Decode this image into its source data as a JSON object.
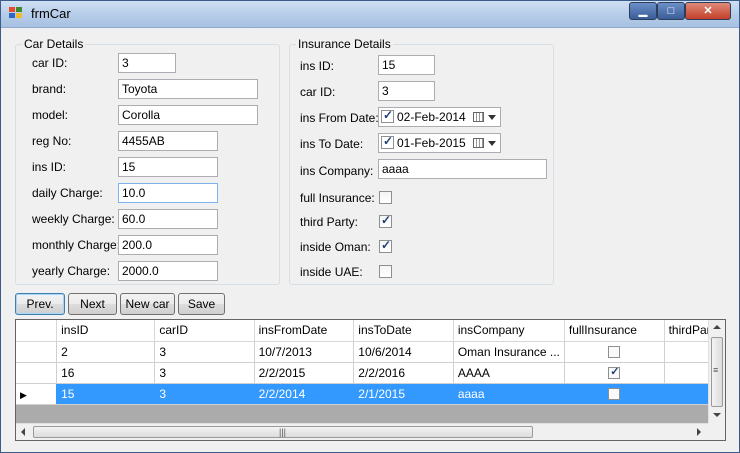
{
  "window": {
    "title": "frmCar"
  },
  "car_details": {
    "title": "Car Details",
    "fields": [
      {
        "label": "car ID:",
        "value": "3"
      },
      {
        "label": "brand:",
        "value": "Toyota"
      },
      {
        "label": "model:",
        "value": "Corolla"
      },
      {
        "label": "reg No:",
        "value": "4455AB"
      },
      {
        "label": "ins ID:",
        "value": "15"
      },
      {
        "label": "daily Charge:",
        "value": "10.0"
      },
      {
        "label": "weekly Charge:",
        "value": "60.0"
      },
      {
        "label": "monthly Charge:",
        "value": "200.0"
      },
      {
        "label": "yearly Charge:",
        "value": "2000.0"
      }
    ]
  },
  "insurance_details": {
    "title": "Insurance Details",
    "ins_id": {
      "label": "ins ID:",
      "value": "15"
    },
    "car_id": {
      "label": "car ID:",
      "value": "3"
    },
    "from_date": {
      "label": "ins From Date:",
      "value": "02-Feb-2014",
      "checked": true
    },
    "to_date": {
      "label": "ins To Date:",
      "value": "01-Feb-2015",
      "checked": true
    },
    "company": {
      "label": "ins Company:",
      "value": "aaaa"
    },
    "full_insurance": {
      "label": "full Insurance:",
      "checked": false
    },
    "third_party": {
      "label": "third Party:",
      "checked": true
    },
    "inside_oman": {
      "label": "inside Oman:",
      "checked": true
    },
    "inside_uae": {
      "label": "inside UAE:",
      "checked": false
    }
  },
  "buttons": {
    "prev": "Prev.",
    "next": "Next",
    "new_car": "New car",
    "save": "Save"
  },
  "grid": {
    "columns": [
      "insID",
      "carID",
      "insFromDate",
      "insToDate",
      "insCompany",
      "fullInsurance",
      "thirdParty"
    ],
    "rows": [
      {
        "insID": "2",
        "carID": "3",
        "insFromDate": "10/7/2013",
        "insToDate": "10/6/2014",
        "insCompany": "Oman Insurance ...",
        "fullInsurance": false,
        "thirdParty": true,
        "selected": false
      },
      {
        "insID": "16",
        "carID": "3",
        "insFromDate": "2/2/2015",
        "insToDate": "2/2/2016",
        "insCompany": "AAAA",
        "fullInsurance": true,
        "thirdParty": false,
        "selected": false
      },
      {
        "insID": "15",
        "carID": "3",
        "insFromDate": "2/2/2014",
        "insToDate": "2/1/2015",
        "insCompany": "aaaa",
        "fullInsurance": false,
        "thirdParty": true,
        "selected": true
      }
    ]
  },
  "colors": {
    "selection": "#3399ff",
    "window_bg": "#f0f0f0",
    "title_bar": "#b7cde9"
  },
  "icons": [
    "app-icon",
    "minimize-icon",
    "maximize-icon",
    "close-icon",
    "calendar-icon",
    "row-pointer-icon"
  ]
}
